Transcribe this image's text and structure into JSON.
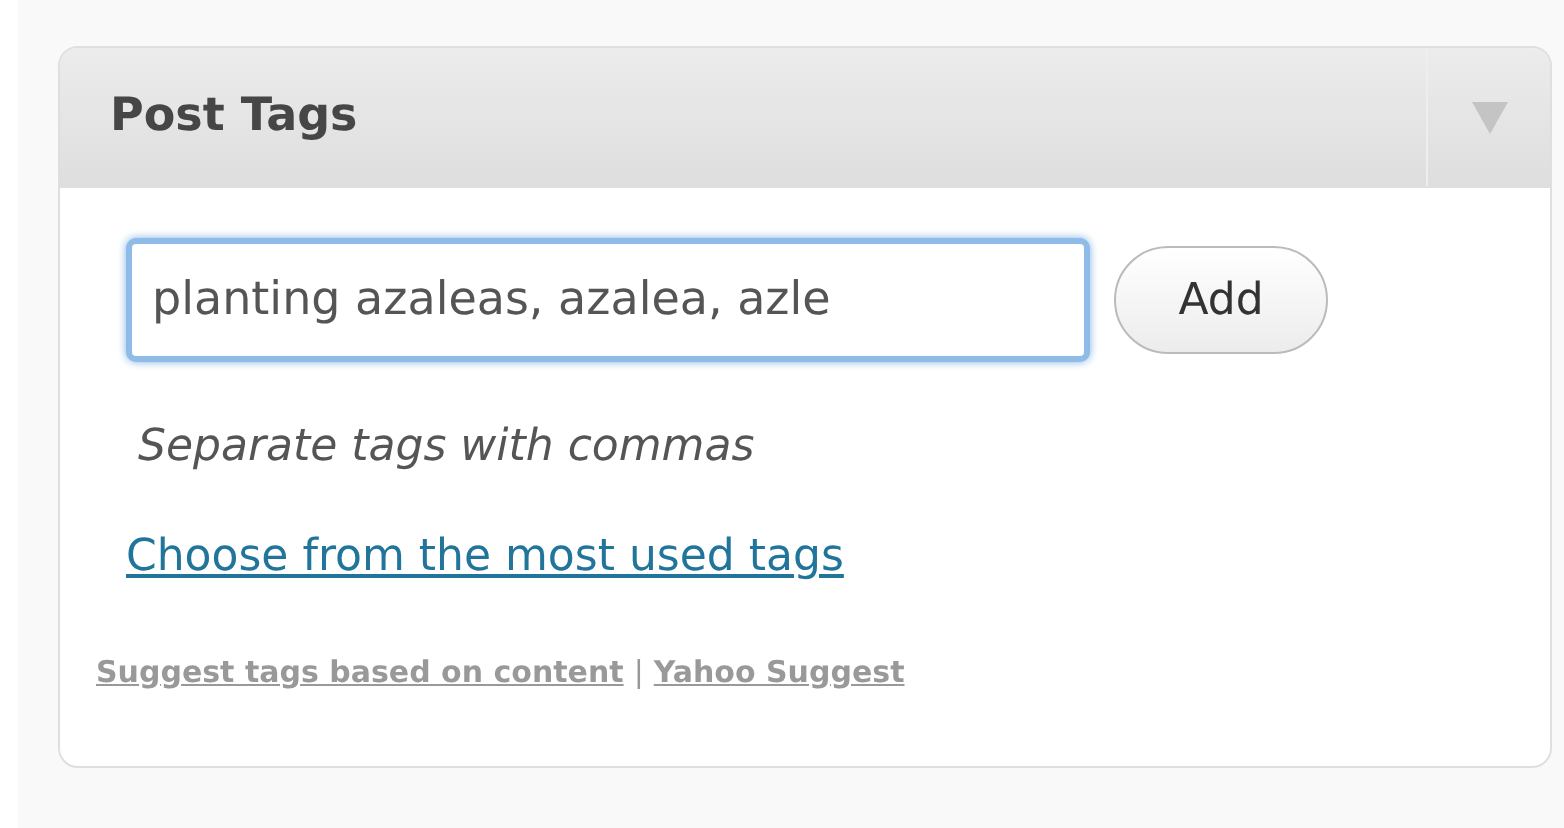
{
  "panel": {
    "title": "Post Tags"
  },
  "tag_input": {
    "value": "planting azaleas, azalea, azle",
    "focused": true
  },
  "add_button": "Add",
  "hint": "Separate tags with commas",
  "most_used_link": "Choose from the most used tags",
  "suggest_links": [
    "Suggest tags based on content",
    "Yahoo Suggest"
  ],
  "separator": "|"
}
